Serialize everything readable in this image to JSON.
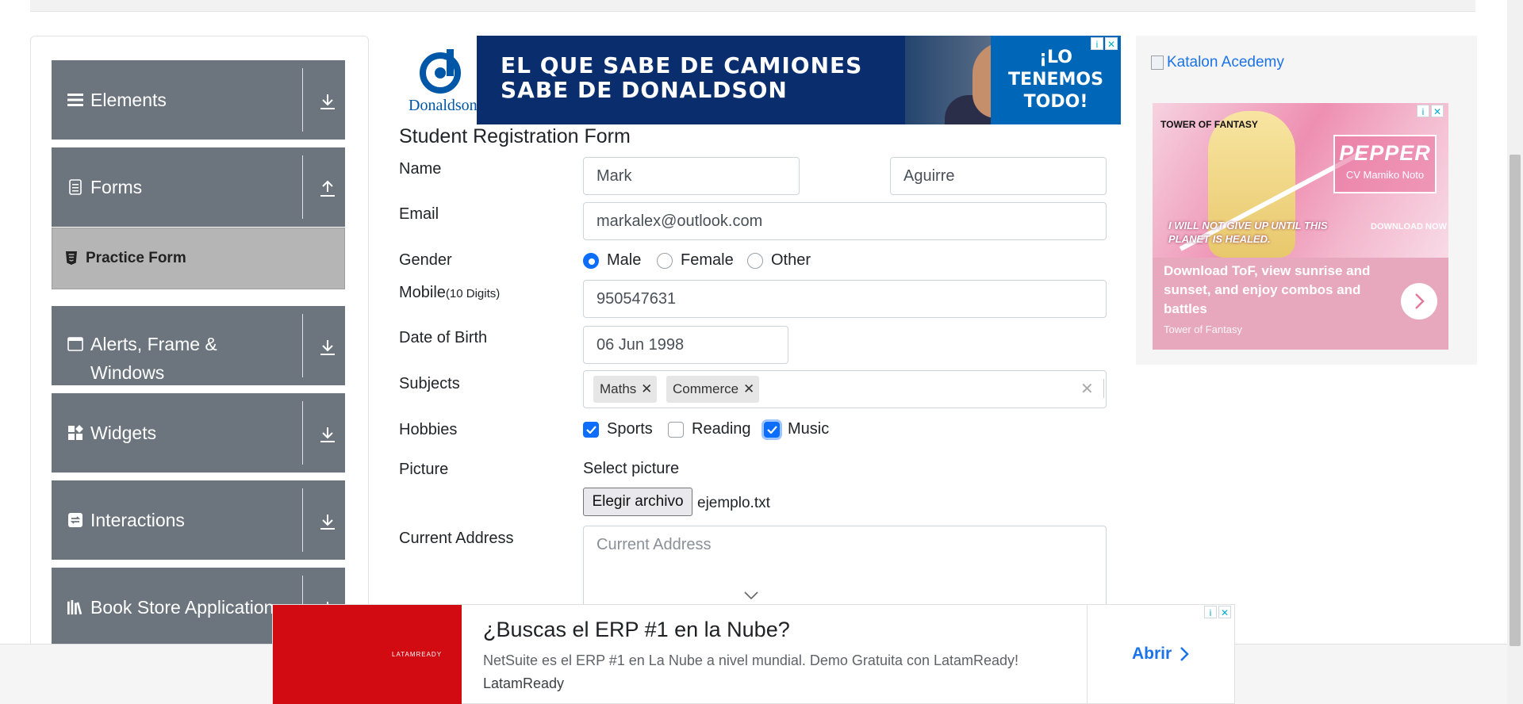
{
  "sidebar": {
    "items": [
      {
        "label": "Elements",
        "icon": "hamburger-icon",
        "toggle": "download-arrow-icon"
      },
      {
        "label": "Forms",
        "icon": "document-icon",
        "toggle": "upload-arrow-icon"
      },
      {
        "label": "Alerts, Frame & Windows",
        "icon": "window-icon",
        "toggle": "download-arrow-icon"
      },
      {
        "label": "Widgets",
        "icon": "widgets-icon",
        "toggle": "download-arrow-icon"
      },
      {
        "label": "Interactions",
        "icon": "interactions-icon",
        "toggle": "download-arrow-icon"
      },
      {
        "label": "Book Store Application",
        "icon": "books-icon",
        "toggle": "download-arrow-icon"
      }
    ],
    "active_subitem": {
      "label": "Practice Form",
      "icon": "html5-icon"
    }
  },
  "top_ad": {
    "brand": "Donaldson.",
    "line1": "EL QUE SABE DE CAMIONES",
    "line2": "SABE DE DONALDSON",
    "cta": "¡LO TENEMOS TODO!"
  },
  "form": {
    "title": "Student Registration Form",
    "labels": {
      "name": "Name",
      "email": "Email",
      "gender": "Gender",
      "mobile": "Mobile",
      "mobile_hint": "(10 Digits)",
      "dob": "Date of Birth",
      "subjects": "Subjects",
      "hobbies": "Hobbies",
      "picture": "Picture",
      "address": "Current Address"
    },
    "first_name": "Mark",
    "last_name": "Aguirre",
    "email": "markalex@outlook.com",
    "gender_options": [
      "Male",
      "Female",
      "Other"
    ],
    "gender_selected": "Male",
    "mobile": "950547631",
    "dob": "06 Jun 1998",
    "subjects": [
      "Maths",
      "Commerce"
    ],
    "hobby_options": [
      {
        "label": "Sports",
        "checked": true
      },
      {
        "label": "Reading",
        "checked": false
      },
      {
        "label": "Music",
        "checked": true
      }
    ],
    "picture_prompt": "Select picture",
    "file_button": "Elegir archivo",
    "file_name": "ejemplo.txt",
    "address_placeholder": "Current Address"
  },
  "right_ad": {
    "katalon": "Katalon Acedemy",
    "brand": "TOWER OF FANTASY",
    "character": "PEPPER",
    "cv": "CV Mamiko Noto",
    "quote": "I WILL NOT GIVE UP UNTIL THIS PLANET IS HEALED.",
    "download": "DOWNLOAD NOW",
    "copy": "Download ToF, view sunrise and sunset, and enjoy combos and battles",
    "source": "Tower of Fantasy"
  },
  "bottom_ad": {
    "logo": "LATAMREADY",
    "headline": "¿Buscas el ERP #1 en la Nube?",
    "description": "NetSuite es el ERP #1 en La Nube a nivel mundial. Demo Gratuita con LatamReady!",
    "sponsor": "LatamReady",
    "cta": "Abrir"
  },
  "colors": {
    "sidebar_bg": "#6c757d",
    "active_bg": "#b5b5b5",
    "accent": "#0d6efd",
    "ad_red": "#d20a11",
    "link": "#1a73e8"
  }
}
